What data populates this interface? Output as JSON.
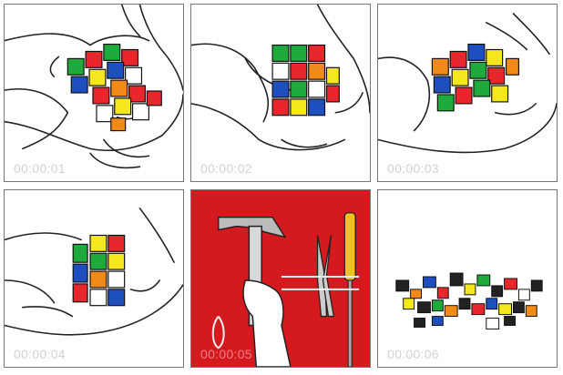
{
  "panels": [
    {
      "timestamp": "00:00:01",
      "scene": "hands twisting cube"
    },
    {
      "timestamp": "00:00:02",
      "scene": "hands twisting cube"
    },
    {
      "timestamp": "00:00:03",
      "scene": "hands twisting cube"
    },
    {
      "timestamp": "00:00:04",
      "scene": "hands gripping cube"
    },
    {
      "timestamp": "00:00:05",
      "scene": "hand taking hammer from tool wall"
    },
    {
      "timestamp": "00:00:06",
      "scene": "smashed cube pieces"
    }
  ],
  "colors": {
    "panel_border": "#777777",
    "tool_wall": "#d41a1e",
    "cube_red": "#e8262b",
    "cube_green": "#1faa3c",
    "cube_blue": "#1d4fbf",
    "cube_yellow": "#f4e81c",
    "cube_orange": "#f28a1a",
    "cube_white": "#ffffff",
    "screwdriver_handle": "#f2c21c"
  }
}
